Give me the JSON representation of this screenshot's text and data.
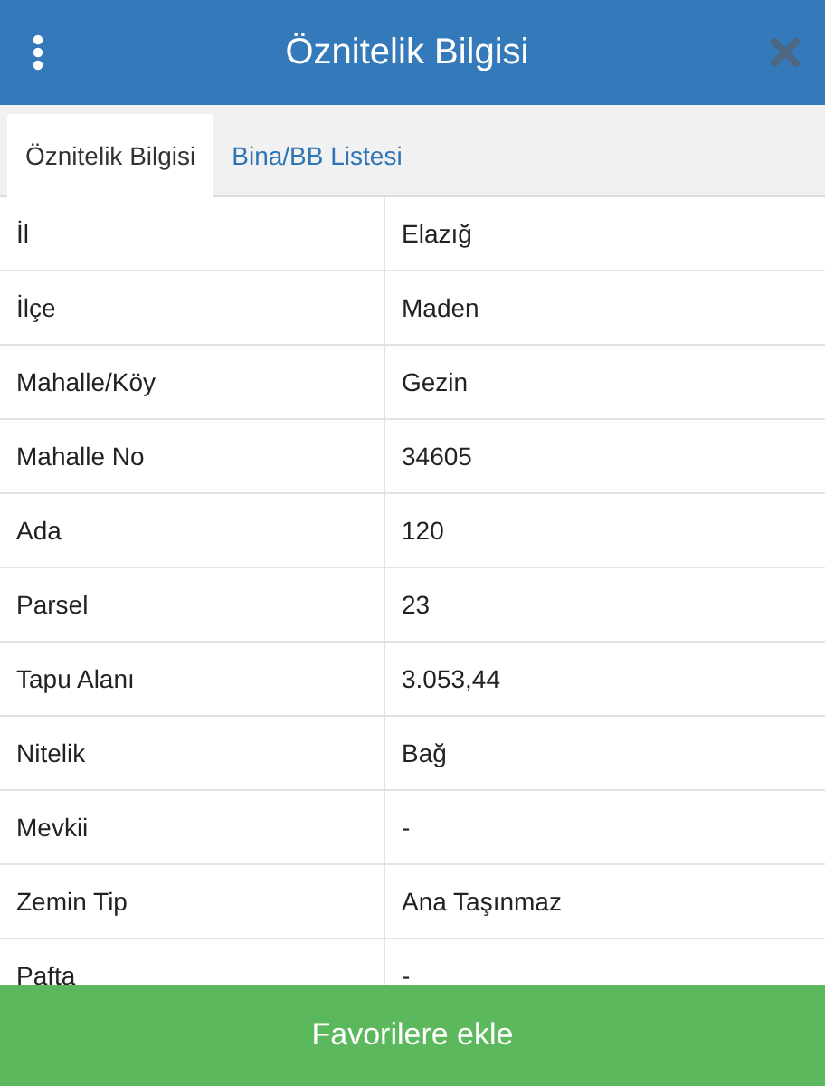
{
  "header": {
    "title": "Öznitelik Bilgisi"
  },
  "tabs": [
    {
      "label": "Öznitelik Bilgisi",
      "selected": true
    },
    {
      "label": "Bina/BB Listesi",
      "selected": false
    }
  ],
  "table": {
    "rows": [
      {
        "label": "İl",
        "value": "Elazığ"
      },
      {
        "label": "İlçe",
        "value": "Maden"
      },
      {
        "label": "Mahalle/Köy",
        "value": "Gezin"
      },
      {
        "label": "Mahalle No",
        "value": "34605"
      },
      {
        "label": "Ada",
        "value": "120"
      },
      {
        "label": "Parsel",
        "value": "23"
      },
      {
        "label": "Tapu Alanı",
        "value": "3.053,44"
      },
      {
        "label": "Nitelik",
        "value": "Bağ"
      },
      {
        "label": "Mevkii",
        "value": "-"
      },
      {
        "label": "Zemin Tip",
        "value": "Ana Taşınmaz"
      },
      {
        "label": "Pafta",
        "value": "-"
      }
    ]
  },
  "footer_button": "Favorilere ekle"
}
